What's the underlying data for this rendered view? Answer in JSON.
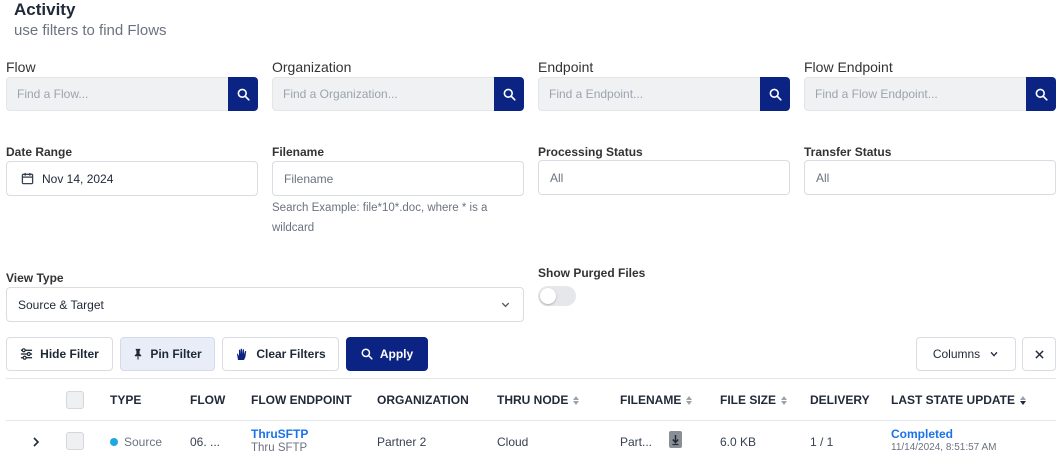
{
  "header": {
    "title": "Activity",
    "subtitle": "use filters to find Flows"
  },
  "filters": {
    "flow": {
      "label": "Flow",
      "placeholder": "Find a Flow..."
    },
    "organization": {
      "label": "Organization",
      "placeholder": "Find a Organization..."
    },
    "endpoint": {
      "label": "Endpoint",
      "placeholder": "Find a Endpoint..."
    },
    "flow_endpoint": {
      "label": "Flow Endpoint",
      "placeholder": "Find a Flow Endpoint..."
    },
    "date_range": {
      "label": "Date Range",
      "value": "Nov 14, 2024"
    },
    "filename": {
      "label": "Filename",
      "placeholder": "Filename",
      "help": "Search Example: file*10*.doc, where * is a wildcard"
    },
    "processing_status": {
      "label": "Processing Status",
      "value": "All"
    },
    "transfer_status": {
      "label": "Transfer Status",
      "value": "All"
    },
    "view_type": {
      "label": "View Type",
      "value": "Source & Target"
    },
    "show_purged": {
      "label": "Show Purged Files",
      "on": false
    }
  },
  "toolbar": {
    "hide_filter": "Hide Filter",
    "pin_filter": "Pin Filter",
    "clear_filters": "Clear Filters",
    "apply": "Apply",
    "columns": "Columns"
  },
  "table": {
    "headers": {
      "type": "TYPE",
      "flow": "FLOW",
      "flow_endpoint": "FLOW ENDPOINT",
      "organization": "ORGANIZATION",
      "thru_node": "THRU NODE",
      "filename": "FILENAME",
      "file_size": "FILE SIZE",
      "delivery": "DELIVERY",
      "last_state_update": "LAST STATE UPDATE"
    },
    "rows": [
      {
        "type": "Source",
        "type_color": "#1ea7e1",
        "flow": "06. ...",
        "flow_endpoint": "ThruSFTP",
        "flow_endpoint_sub": "Thru SFTP",
        "organization": "Partner 2",
        "thru_node": "Cloud",
        "filename": "Part...",
        "file_size": "6.0 KB",
        "delivery": "1 / 1",
        "last_state": "Completed",
        "last_state_time": "11/14/2024, 8:51:57 AM"
      }
    ]
  },
  "colors": {
    "brand": "#0b2483",
    "link": "#1a73e8",
    "status_source": "#1ea7e1"
  }
}
